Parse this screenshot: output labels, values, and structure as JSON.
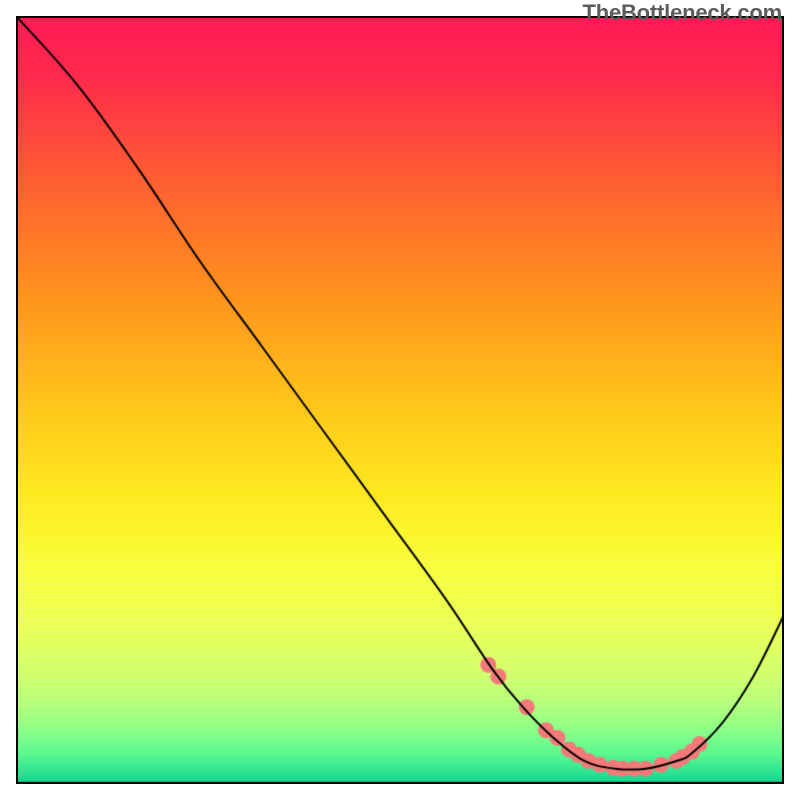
{
  "watermark": "TheBottleneck.com",
  "chart_data": {
    "type": "line",
    "title": "",
    "xlabel": "",
    "ylabel": "",
    "xlim": [
      0,
      100
    ],
    "ylim": [
      0,
      100
    ],
    "series": [
      {
        "name": "curve",
        "color": "#000000",
        "width": 2,
        "x": [
          0,
          8,
          16,
          24,
          32,
          40,
          48,
          56,
          62,
          66,
          70,
          74,
          78,
          82,
          86,
          88,
          92,
          96,
          100
        ],
        "values": [
          100,
          91,
          80,
          68,
          57,
          46,
          35,
          24,
          15,
          10,
          6,
          3,
          2,
          2,
          3,
          4,
          8,
          14,
          22
        ]
      }
    ],
    "markers": {
      "name": "highlight-points",
      "color": "#f47a7a",
      "radius": 8,
      "x": [
        61.5,
        62.8,
        66.5,
        69.0,
        70.5,
        72.0,
        73.2,
        74.5,
        76.0,
        77.8,
        79.0,
        80.5,
        82.0,
        84.0,
        86.0,
        86.8,
        88.0,
        89.0
      ],
      "values": [
        15.5,
        14.0,
        10.0,
        7.0,
        6.0,
        4.5,
        3.8,
        3.0,
        2.5,
        2.1,
        2.0,
        2.0,
        2.0,
        2.5,
        3.0,
        3.5,
        4.2,
        5.2
      ]
    },
    "background_gradient": {
      "stops": [
        {
          "pos": 0.0,
          "color": "#ff1a55"
        },
        {
          "pos": 0.08,
          "color": "#ff2a4d"
        },
        {
          "pos": 0.2,
          "color": "#ff5a35"
        },
        {
          "pos": 0.35,
          "color": "#ff8e1e"
        },
        {
          "pos": 0.5,
          "color": "#ffc41a"
        },
        {
          "pos": 0.62,
          "color": "#ffe920"
        },
        {
          "pos": 0.72,
          "color": "#f9ff39"
        },
        {
          "pos": 0.8,
          "color": "#e9ff55"
        },
        {
          "pos": 0.86,
          "color": "#cfff6a"
        },
        {
          "pos": 0.9,
          "color": "#b0ff7c"
        },
        {
          "pos": 0.93,
          "color": "#8bff88"
        },
        {
          "pos": 0.96,
          "color": "#5cf98f"
        },
        {
          "pos": 0.985,
          "color": "#2de493"
        },
        {
          "pos": 1.0,
          "color": "#0dcf8f"
        }
      ]
    }
  }
}
